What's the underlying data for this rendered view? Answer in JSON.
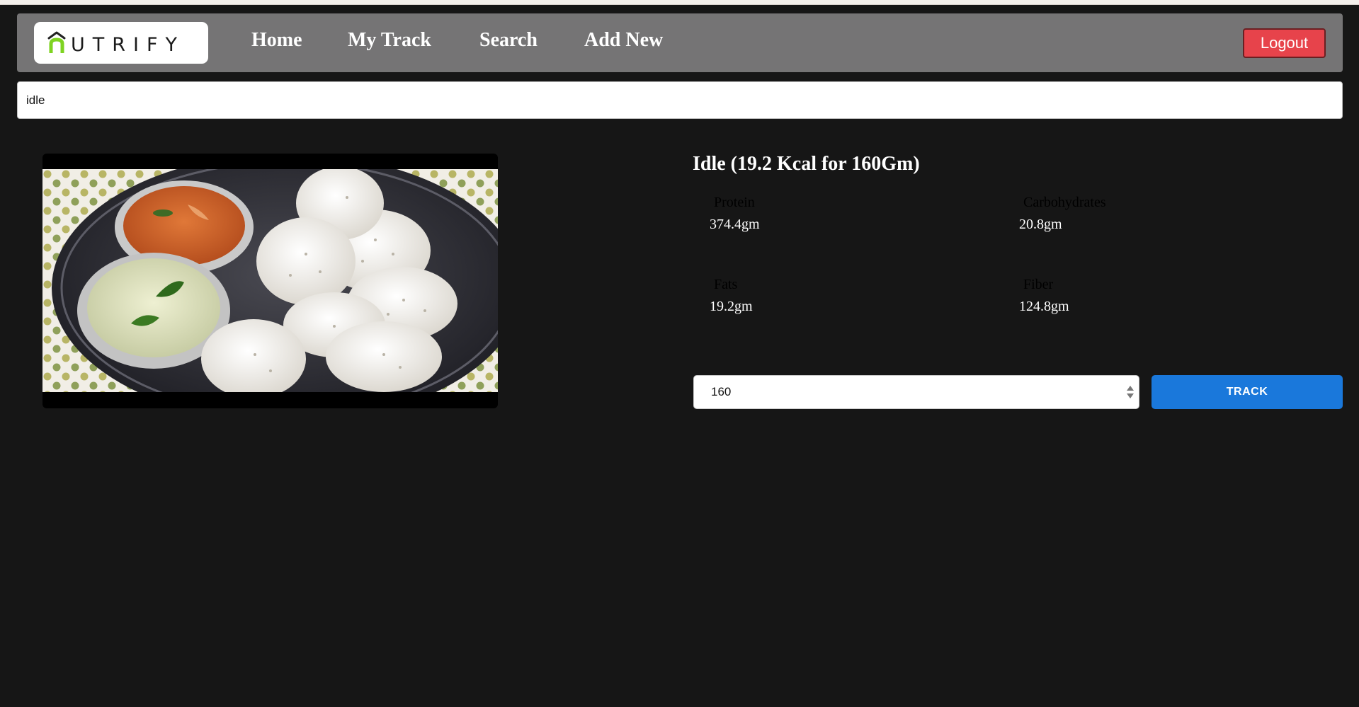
{
  "brand": {
    "name": "UTRIFY",
    "accent_color": "#7ed321"
  },
  "nav": {
    "links": [
      {
        "label": "Home"
      },
      {
        "label": "My Track"
      },
      {
        "label": "Search"
      },
      {
        "label": "Add New"
      }
    ],
    "logout_label": "Logout"
  },
  "search": {
    "value": "idle"
  },
  "food": {
    "title": "Idle (19.2 Kcal for 160Gm)",
    "image_icon": "food-photo-idli",
    "nutrients": [
      {
        "label": "Protein",
        "value": "374.4gm"
      },
      {
        "label": "Carbohydrates",
        "value": "20.8gm"
      },
      {
        "label": "Fats",
        "value": "19.2gm"
      },
      {
        "label": "Fiber",
        "value": "124.8gm"
      }
    ]
  },
  "tracker": {
    "quantity": "160",
    "button_label": "TRACK"
  },
  "colors": {
    "background": "#161616",
    "navbar": "#757475",
    "logout": "#e7434b",
    "track": "#1a78db"
  }
}
